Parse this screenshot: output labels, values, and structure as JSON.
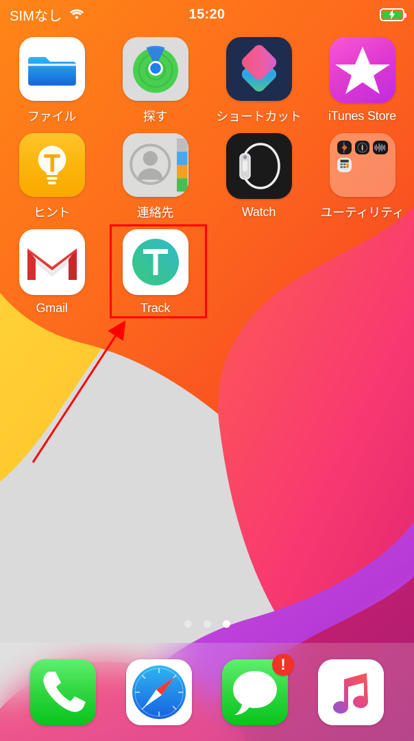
{
  "status_bar": {
    "carrier": "SIMなし",
    "wifi_icon": "wifi-icon",
    "time": "15:20",
    "battery_icon": "battery-charging-icon",
    "battery_color": "#2ecc3f"
  },
  "home_screen": {
    "apps": [
      {
        "label": "ファイル",
        "icon": "files-icon"
      },
      {
        "label": "探す",
        "icon": "find-my-icon"
      },
      {
        "label": "ショートカット",
        "icon": "shortcuts-icon"
      },
      {
        "label": "iTunes Store",
        "icon": "itunes-store-icon"
      },
      {
        "label": "ヒント",
        "icon": "tips-icon"
      },
      {
        "label": "連絡先",
        "icon": "contacts-icon"
      },
      {
        "label": "Watch",
        "icon": "watch-icon"
      },
      {
        "label": "ユーティリティ",
        "icon": "utilities-folder-icon"
      },
      {
        "label": "Gmail",
        "icon": "gmail-icon"
      },
      {
        "label": "Track",
        "icon": "track-icon"
      }
    ],
    "utilities_folder_contents": [
      "measure-icon",
      "compass-icon",
      "voice-memos-icon",
      "calculator-icon"
    ],
    "page_dots": {
      "total": 3,
      "active_index": 2
    }
  },
  "dock": {
    "apps": [
      {
        "label": "Phone",
        "icon": "phone-icon",
        "badge": ""
      },
      {
        "label": "Safari",
        "icon": "safari-icon",
        "badge": ""
      },
      {
        "label": "Messages",
        "icon": "messages-icon",
        "badge": "!"
      },
      {
        "label": "Music",
        "icon": "music-icon",
        "badge": ""
      }
    ]
  },
  "annotation": {
    "highlight_color": "#ff0000",
    "highlight_target": "Track",
    "arrow_color": "#ff0000"
  },
  "track_app": {
    "letter": "T",
    "gradient_from": "#3dc98c",
    "gradient_to": "#35b9c4"
  }
}
